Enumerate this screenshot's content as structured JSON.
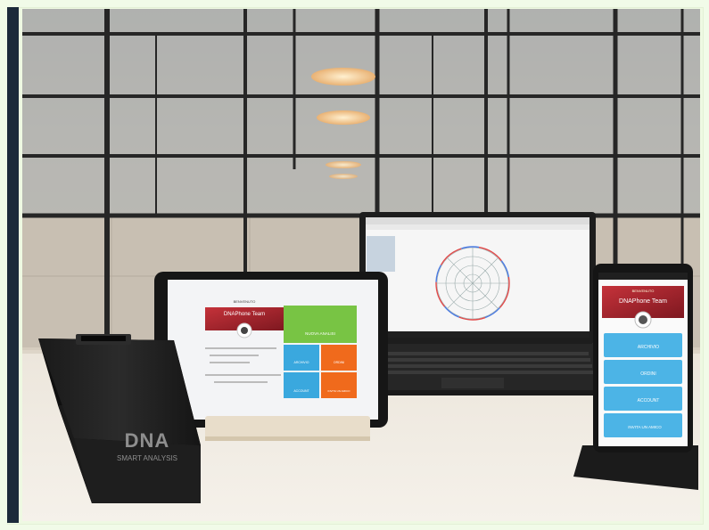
{
  "photo": {
    "tablet": {
      "header_small": "BENVENUTO",
      "team_name": "DNAPhone Team",
      "tile_new_analysis": "NUOVA ANALISI",
      "tile_archive": "ARCHIVIO",
      "tile_orders": "ORDINI",
      "tile_account": "ACCOUNT",
      "tile_invite": "INVITA UN AMICO"
    },
    "phone": {
      "header_small": "BENVENUTO",
      "team_name": "DNAPhone Team",
      "btn_archive": "ARCHIVIO",
      "btn_orders": "ORDINI",
      "btn_account": "ACCOUNT",
      "btn_invite": "INVITA UN AMICO"
    },
    "device": {
      "logo_text": "DNA",
      "brand_line": "SMART ANALYSIS"
    },
    "colors": {
      "wall": "#cbc4b8",
      "grid": "#2a2a2a",
      "green_tile": "#78c444",
      "blue_tile": "#3aa8de",
      "orange_tile": "#f06a1c",
      "red_header": "#a3242e",
      "phone_button": "#4cb4e6",
      "lamp": "#f2c48c"
    }
  }
}
